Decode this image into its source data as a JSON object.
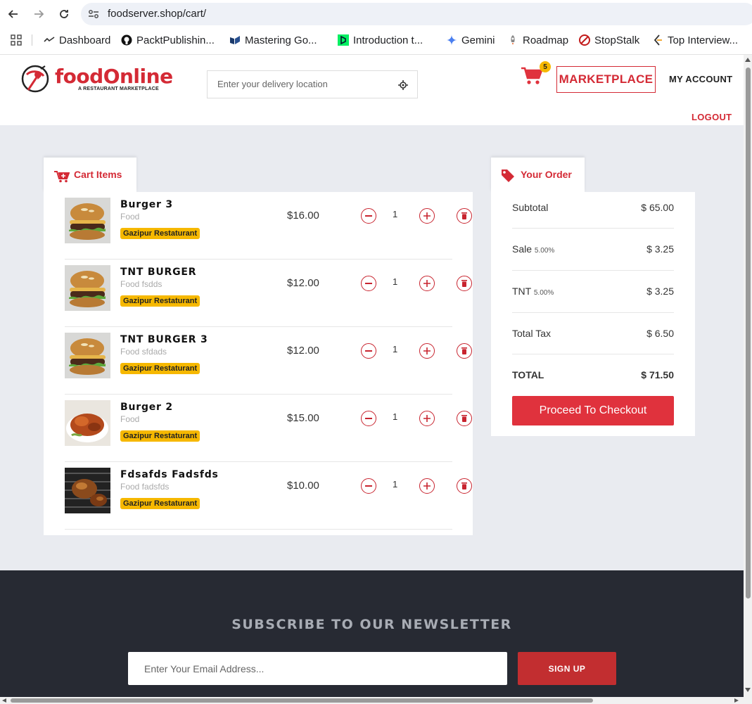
{
  "browser": {
    "url": "foodserver.shop/cart/",
    "bookmarks": [
      {
        "label": "Dashboard",
        "icon": "dashboard-icon"
      },
      {
        "label": "PacktPublishin...",
        "icon": "github-icon"
      },
      {
        "label": "Mastering Go...",
        "icon": "book-icon"
      },
      {
        "label": "Introduction t...",
        "icon": "datacamp-icon"
      },
      {
        "label": "Gemini",
        "icon": "gemini-icon"
      },
      {
        "label": "Roadmap",
        "icon": "rocket-icon"
      },
      {
        "label": "StopStalk",
        "icon": "stopstalk-icon"
      },
      {
        "label": "Top Interview...",
        "icon": "leetcode-icon"
      }
    ]
  },
  "header": {
    "logo_text": "foodOnline",
    "logo_tagline": "A RESTAURANT MARKETPLACE",
    "location_placeholder": "Enter your delivery location",
    "cart_count": "5",
    "marketplace_label": "MARKETPLACE",
    "my_account_label": "MY ACCOUNT",
    "logout_label": "LOGOUT"
  },
  "cart": {
    "title": "Cart Items",
    "items": [
      {
        "name": "Burger 3",
        "description": "Food",
        "restaurant": "Gazipur Restaturant",
        "price": "$16.00",
        "quantity": "1",
        "image": "burger"
      },
      {
        "name": "TNT BURGER",
        "description": "Food fsdds",
        "restaurant": "Gazipur Restaturant",
        "price": "$12.00",
        "quantity": "1",
        "image": "burger"
      },
      {
        "name": "TNT BURGER 3",
        "description": "Food sfdads",
        "restaurant": "Gazipur Restaturant",
        "price": "$12.00",
        "quantity": "1",
        "image": "burger"
      },
      {
        "name": "Burger 2",
        "description": "Food",
        "restaurant": "Gazipur Restaturant",
        "price": "$15.00",
        "quantity": "1",
        "image": "roast-chicken"
      },
      {
        "name": "Fdsafds Fadsfds",
        "description": "Food fadsfds",
        "restaurant": "Gazipur Restaturant",
        "price": "$10.00",
        "quantity": "1",
        "image": "grilled-chicken"
      }
    ]
  },
  "order": {
    "title": "Your Order",
    "subtotal_label": "Subtotal",
    "subtotal_value": "$ 65.00",
    "taxes": [
      {
        "label": "Sale",
        "rate": "5.00%",
        "value": "$ 3.25"
      },
      {
        "label": "TNT",
        "rate": "5.00%",
        "value": "$ 3.25"
      }
    ],
    "total_tax_label": "Total Tax",
    "total_tax_value": "$ 6.50",
    "total_label": "TOTAL",
    "total_value": "$ 71.50",
    "checkout_label": "Proceed To Checkout"
  },
  "newsletter": {
    "title": "SUBSCRIBE TO OUR NEWSLETTER",
    "email_placeholder": "Enter Your Email Address...",
    "signup_label": "SIGN UP"
  },
  "colors": {
    "brand_red": "#d42a35",
    "badge_yellow": "#f6b800",
    "footer_bg": "#272a33",
    "page_bg": "#e9ebf0"
  }
}
